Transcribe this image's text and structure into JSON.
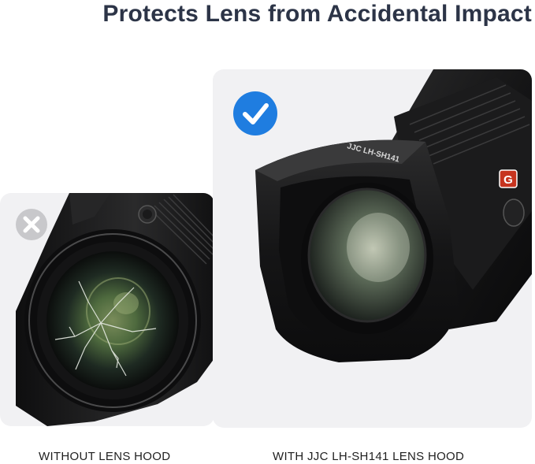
{
  "header": {
    "title": "Protects Lens from Accidental Impact"
  },
  "panels": {
    "left": {
      "caption": "WITHOUT LENS HOOD",
      "badge_icon": "x-mark-icon",
      "badge_color": "#c8c8cb"
    },
    "right": {
      "caption": "WITH JJC LH-SH141 LENS HOOD",
      "badge_icon": "checkmark-icon",
      "badge_color": "#1f7de0",
      "hood_brand": "JJC LH-SH141",
      "lens_badge": "G"
    }
  },
  "colors": {
    "title": "#2c3447",
    "card_bg": "#f1f1f3",
    "lens_body": "#1b1b1c",
    "accent_orange": "#e1502b"
  }
}
